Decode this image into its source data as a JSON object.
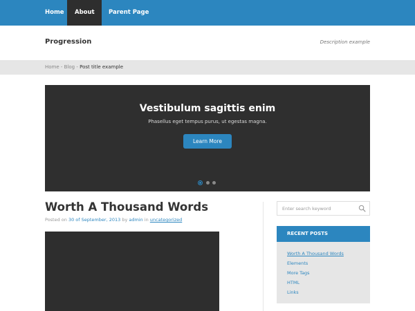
{
  "nav": {
    "items": [
      {
        "label": "Home"
      },
      {
        "label": "About"
      },
      {
        "label": "Parent Page"
      }
    ],
    "about_chevron": "⌄"
  },
  "header": {
    "site_title": "Progression",
    "description": "Description example"
  },
  "breadcrumb": {
    "home": "Home",
    "sep1": " - ",
    "blog": "Blog",
    "sep2": " - ",
    "current": "Post title example"
  },
  "slider": {
    "title": "Vestibulum sagittis enim",
    "text": "Phasellus eget tempus purus, ut egestas magna.",
    "button": "Learn More",
    "dots": 3,
    "active_dot": 1
  },
  "post": {
    "title": "Worth A Thousand Words",
    "meta_prefix": "Posted on ",
    "date": "30 of September, 2013",
    "by": " by ",
    "author": "admin",
    "in": " in ",
    "category": "uncategorized"
  },
  "sidebar": {
    "search_placeholder": "Enter search keyword",
    "recent_posts_title": "RECENT POSTS",
    "recent_posts": [
      "Worth A Thousand Words",
      "Elements",
      "More Tags",
      "HTML",
      "Links"
    ]
  },
  "colors": {
    "accent": "#2c86bf",
    "dark": "#2e2e2e",
    "light_gray": "#e6e6e6"
  }
}
